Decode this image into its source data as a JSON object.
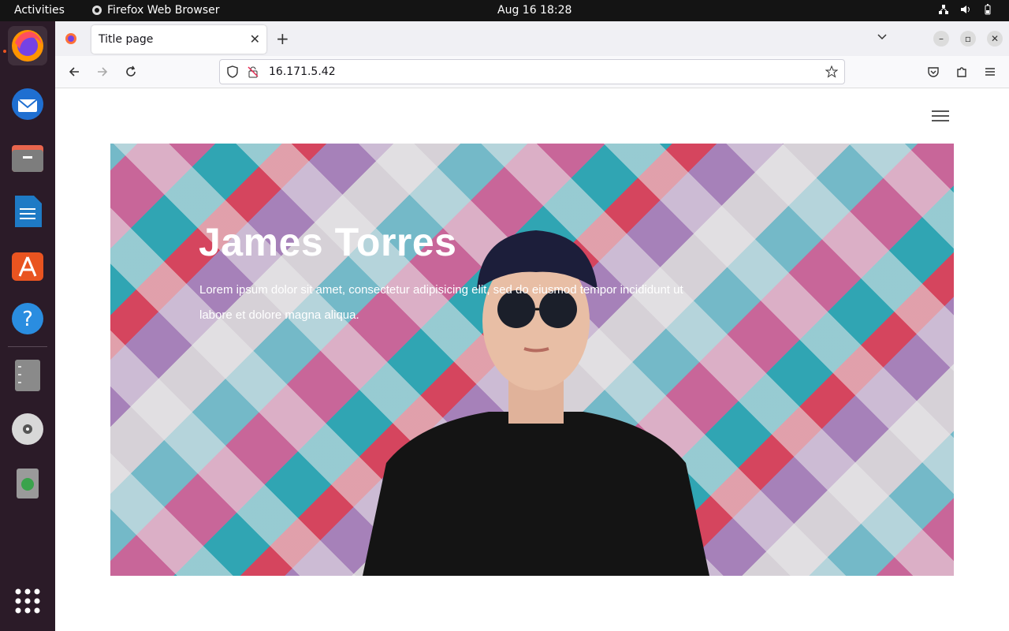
{
  "topbar": {
    "activities": "Activities",
    "app_name": "Firefox Web Browser",
    "clock": "Aug 16  18:28"
  },
  "dock": {
    "items": [
      "firefox-icon",
      "thunderbird-icon",
      "files-icon",
      "writer-icon",
      "app-center-icon",
      "help-icon",
      "text-editor-icon",
      "disc-icon",
      "trash-icon",
      "apps-grid-icon"
    ]
  },
  "browser": {
    "tab_title": "Title page",
    "url": "16.171.5.42"
  },
  "page": {
    "hero_title": "James Torres",
    "hero_text": "Lorem ipsum dolor sit amet, consectetur adipisicing elit, sed do eiusmod tempor incididunt ut labore et dolore magna aliqua."
  },
  "colors": {
    "accent": "#e95420",
    "topbar_bg": "#141414",
    "dock_bg": "#2b1b28"
  }
}
